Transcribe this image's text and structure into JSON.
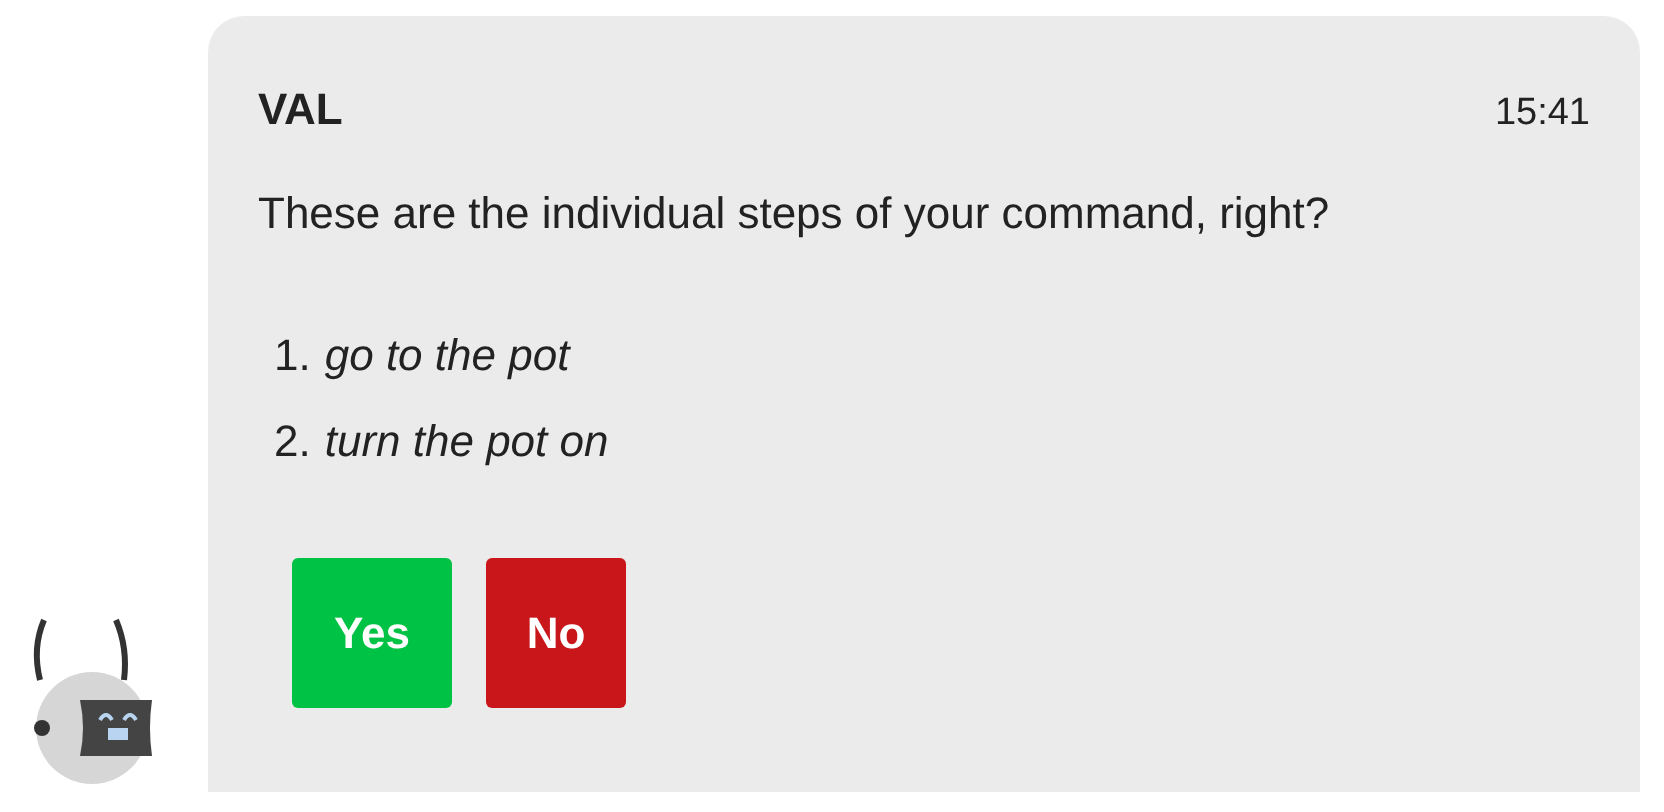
{
  "message": {
    "sender": "VAL",
    "time": "15:41",
    "text": "These are the individual steps of your command, right?",
    "steps": [
      {
        "number": "1.",
        "text": "go to the pot"
      },
      {
        "number": "2.",
        "text": "turn the pot on"
      }
    ],
    "buttons": [
      {
        "label": "Yes",
        "kind": "confirm"
      },
      {
        "label": "No",
        "kind": "deny"
      }
    ]
  }
}
